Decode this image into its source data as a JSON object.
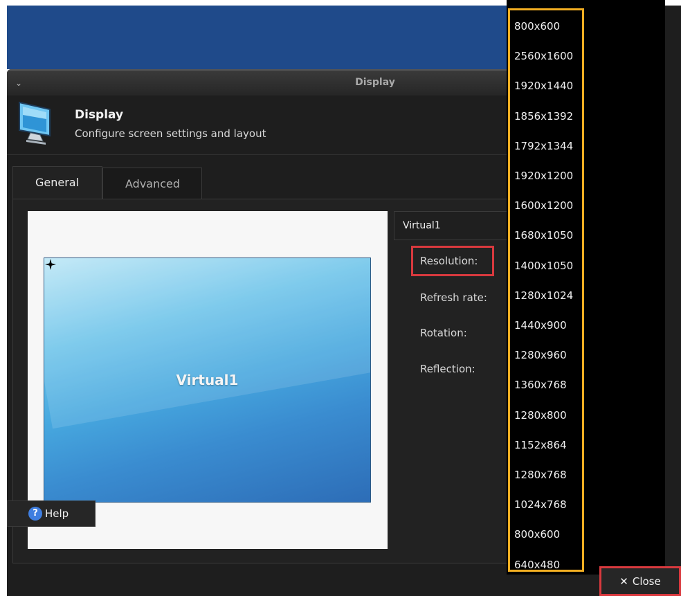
{
  "window": {
    "title": "Display",
    "close_glyph": "×",
    "menu_glyph": "⌄"
  },
  "header": {
    "title": "Display",
    "subtitle": "Configure screen settings and layout",
    "icon": "monitor-icon"
  },
  "tabs": [
    {
      "label": "General",
      "active": true
    },
    {
      "label": "Advanced",
      "active": false
    }
  ],
  "preview": {
    "monitor_label": "Virtual1",
    "primary_icon": "star-icon"
  },
  "output_select": {
    "value": "Virtual1"
  },
  "fields": {
    "resolution": "Resolution:",
    "refresh_rate": "Refresh rate:",
    "rotation": "Rotation:",
    "reflection": "Reflection:"
  },
  "resolution_options": [
    "800x600",
    "2560x1600",
    "1920x1440",
    "1856x1392",
    "1792x1344",
    "1920x1200",
    "1600x1200",
    "1680x1050",
    "1400x1050",
    "1280x1024",
    "1440x900",
    "1280x960",
    "1360x768",
    "1280x800",
    "1152x864",
    "1280x768",
    "1024x768",
    "800x600",
    "640x480"
  ],
  "footer": {
    "help_label": "Help",
    "help_glyph": "?",
    "close_label": "Close",
    "close_glyph": "✕"
  },
  "colors": {
    "highlight_red": "#d9393e",
    "highlight_orange": "#f2ae22",
    "desktop_blue": "#1f4a8a"
  }
}
